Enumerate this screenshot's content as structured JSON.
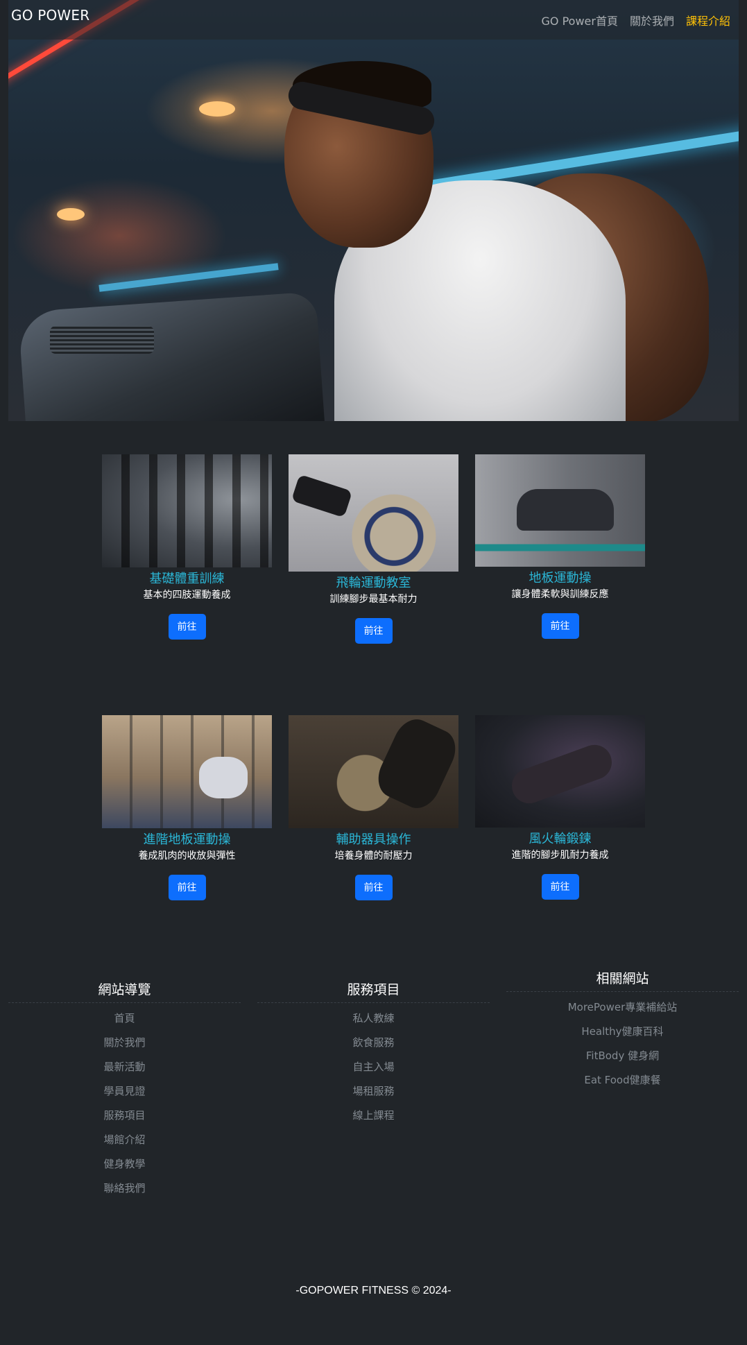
{
  "navbar": {
    "brand": "GO POWER",
    "links": [
      {
        "label": "GO Power首頁"
      },
      {
        "label": "關於我們"
      },
      {
        "label": "課程介紹"
      }
    ],
    "active_color": "#ffc107"
  },
  "courses": [
    {
      "title": "基礎體重訓練",
      "desc": "基本的四肢運動養成",
      "button": "前往"
    },
    {
      "title": "飛輪運動教室",
      "desc": "訓練腳步最基本耐力",
      "button": "前往"
    },
    {
      "title": "地板運動操",
      "desc": "讓身體柔軟與訓練反應",
      "button": "前往"
    },
    {
      "title": "進階地板運動操",
      "desc": "養成肌肉的收放與彈性",
      "button": "前往"
    },
    {
      "title": "輔助器具操作",
      "desc": "培養身體的耐壓力",
      "button": "前往"
    },
    {
      "title": "風火輪鍛鍊",
      "desc": "進階的腳步肌耐力養成",
      "button": "前往"
    }
  ],
  "footer": {
    "nav": {
      "heading": "網站導覽",
      "items": [
        "首頁",
        "關於我們",
        "最新活動",
        "學員見證",
        "服務項目",
        "場館介紹",
        "健身教學",
        "聯絡我們"
      ]
    },
    "services": {
      "heading": "服務項目",
      "items": [
        "私人教練",
        "飲食服務",
        "自主入場",
        "場租服務",
        "線上課程"
      ]
    },
    "related": {
      "heading": "相關網站",
      "items": [
        "MorePower專業補給站",
        "Healthy健康百科",
        "FitBody 健身網",
        "Eat Food健康餐"
      ]
    },
    "copyright": "-GOPOWER FITNESS © 2024-"
  },
  "colors": {
    "background": "#212529",
    "course_title": "#2bb6d6",
    "button": "#0d6efd",
    "footer_link": "#838a91"
  }
}
